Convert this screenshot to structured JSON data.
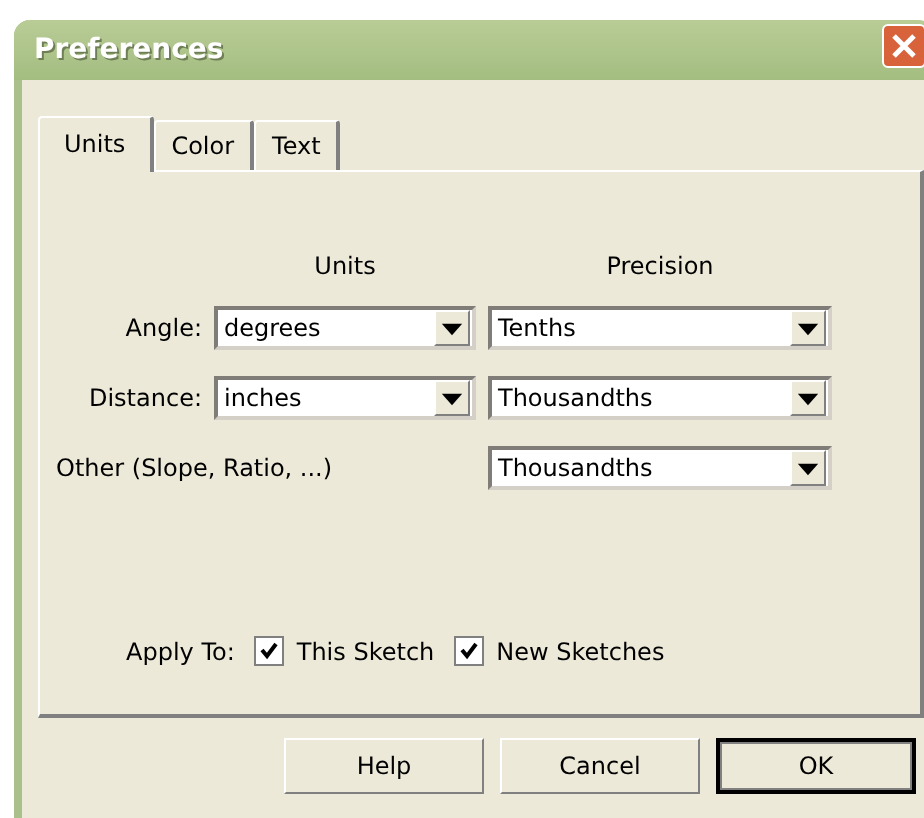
{
  "window": {
    "title": "Preferences"
  },
  "tabs": [
    {
      "label": "Units",
      "selected": true
    },
    {
      "label": "Color",
      "selected": false
    },
    {
      "label": "Text",
      "selected": false
    }
  ],
  "headers": {
    "units": "Units",
    "precision": "Precision"
  },
  "rows": [
    {
      "label": "Angle:",
      "unit": "degrees",
      "precision": "Tenths"
    },
    {
      "label": "Distance:",
      "unit": "inches",
      "precision": "Thousandths"
    },
    {
      "label": "Other (Slope, Ratio, ...)",
      "precision": "Thousandths"
    }
  ],
  "apply_to": {
    "label": "Apply To:",
    "options": [
      {
        "label": "This Sketch",
        "checked": true
      },
      {
        "label": "New Sketches",
        "checked": true
      }
    ]
  },
  "buttons": [
    {
      "label": "Help",
      "default": false
    },
    {
      "label": "Cancel",
      "default": false
    },
    {
      "label": "OK",
      "default": true
    }
  ]
}
